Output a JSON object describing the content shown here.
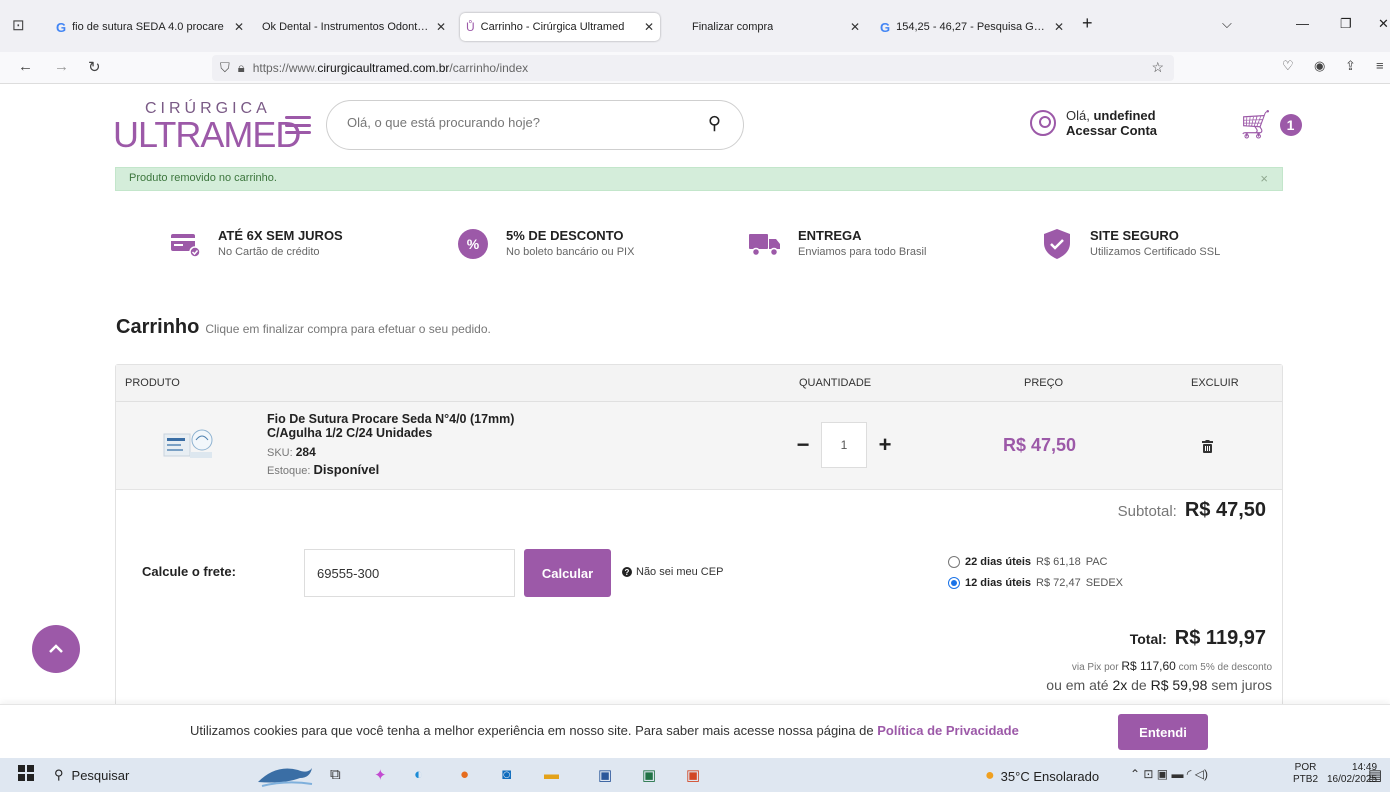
{
  "browser": {
    "tabs": [
      {
        "title": "fio de sutura SEDA 4.0 procare",
        "icon": "google-icon"
      },
      {
        "title": "Ok Dental - Instrumentos Odontoló",
        "icon": "none"
      },
      {
        "title": "Carrinho - Cirúrgica Ultramed",
        "icon": "ultramed-icon",
        "active": true
      },
      {
        "title": "Finalizar compra",
        "icon": "none"
      },
      {
        "title": "154,25 - 46,27 - Pesquisa Googl",
        "icon": "google-icon"
      }
    ],
    "url_prefix": "https://www.",
    "url_domain": "cirurgicaultramed.com.br",
    "url_path": "/carrinho/index"
  },
  "header": {
    "logo_top": "CIRÚRGICA",
    "logo_main": "ULTRAMED",
    "search_placeholder": "Olá, o que está procurando hoje?",
    "greeting": "Olá,",
    "user_name": "undefined",
    "account_link": "Acessar Conta",
    "cart_count": "1"
  },
  "alert": {
    "message": "Produto removido no carrinho.",
    "close": "×"
  },
  "features": [
    {
      "title": "ATÉ 6X SEM JUROS",
      "subtitle": "No Cartão de crédito",
      "icon": "credit-card-icon"
    },
    {
      "title": "5% DE DESCONTO",
      "subtitle": "No boleto bancário ou PIX",
      "icon": "percent-badge-icon"
    },
    {
      "title": "ENTREGA",
      "subtitle": "Enviamos para todo Brasil",
      "icon": "truck-icon"
    },
    {
      "title": "SITE SEGURO",
      "subtitle": "Utilizamos Certificado SSL",
      "icon": "shield-check-icon"
    }
  ],
  "cart": {
    "title": "Carrinho",
    "subtitle": "Clique em finalizar compra para efetuar o seu pedido.",
    "columns": {
      "product": "PRODUTO",
      "quantity": "QUANTIDADE",
      "price": "PREÇO",
      "remove": "EXCLUIR"
    },
    "item": {
      "name": "Fio De Sutura Procare Seda N°4/0 (17mm) C/Agulha 1/2 C/24 Unidades",
      "sku_label": "SKU:",
      "sku": "284",
      "stock_label": "Estoque:",
      "stock": "Disponível",
      "quantity": "1",
      "price": "R$ 47,50"
    },
    "subtotal_label": "Subtotal:",
    "subtotal": "R$ 47,50",
    "shipping": {
      "label": "Calcule o frete:",
      "cep": "69555-300",
      "button": "Calcular",
      "help": "Não sei meu CEP",
      "options": [
        {
          "days": "22 dias úteis",
          "price": "R$ 61,18",
          "service": "PAC",
          "selected": false
        },
        {
          "days": "12 dias úteis",
          "price": "R$ 72,47",
          "service": "SEDEX",
          "selected": true
        }
      ]
    },
    "total_label": "Total:",
    "total": "R$ 119,97",
    "pix_prefix": "via Pix por",
    "pix_value": "R$ 117,60",
    "pix_with": "com",
    "pix_discount": "5% de desconto",
    "installments_prefix": "ou em até",
    "installments_count": "2x",
    "installments_of": "de",
    "installments_value": "R$ 59,98",
    "installments_suffix": "sem juros"
  },
  "cookie": {
    "text": "Utilizamos cookies para que você tenha a melhor experiência em nosso site. Para saber mais acesse nossa página de",
    "link": "Política de Privacidade",
    "button": "Entendi"
  },
  "taskbar": {
    "search": "Pesquisar",
    "weather": "35°C  Ensolarado",
    "lang_top": "POR",
    "lang_bottom": "PTB2",
    "time": "14:49",
    "date": "16/02/2025"
  },
  "colors": {
    "brand": "#9c59a8",
    "alert_bg": "#d4edda"
  }
}
